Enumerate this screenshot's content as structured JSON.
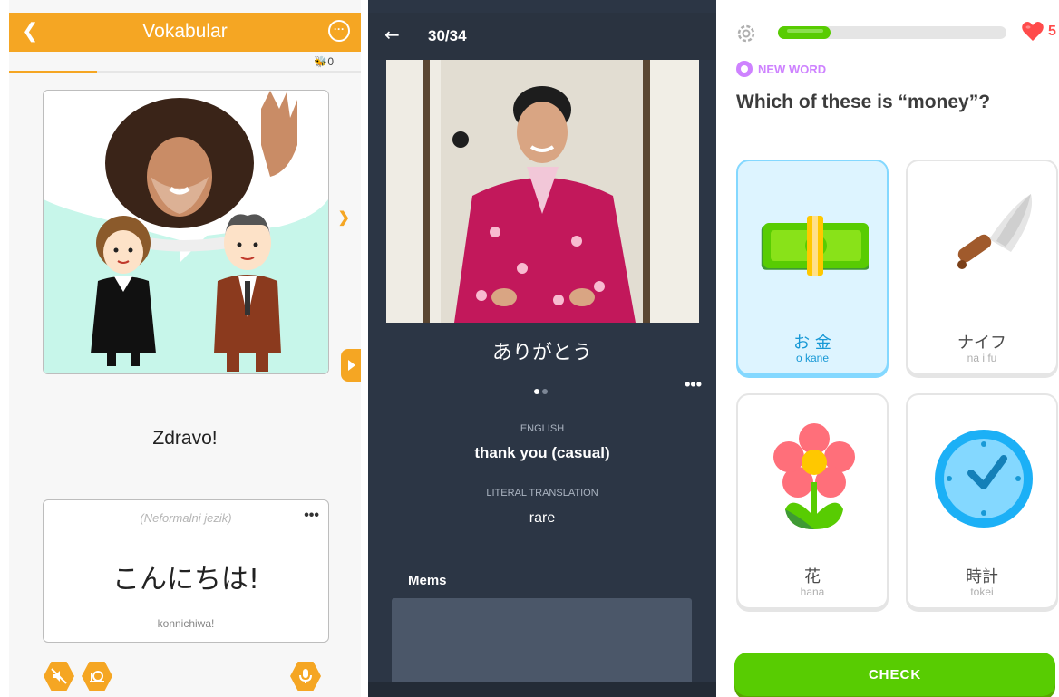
{
  "panel1": {
    "title": "Vokabular",
    "back_icon": "chevron-left-icon",
    "menu_icon": "more-circle-icon",
    "score": "0",
    "word": "Zdravo!",
    "note": "(Neformalni jezik)",
    "japanese": "こんにちは!",
    "romaji": "konnichiwa!",
    "accent": "#f5a623"
  },
  "panel2": {
    "counter": "30/34",
    "japanese": "ありがとう",
    "english_label": "ENGLISH",
    "english": "thank you (casual)",
    "literal_label": "LITERAL TRANSLATION",
    "literal": "rare",
    "mems_label": "Mems",
    "page_active": 1,
    "page_count": 2
  },
  "panel3": {
    "progress": 0.23,
    "hearts": "5",
    "new_word_label": "NEW WORD",
    "question": "Which of these is “money”?",
    "choices": [
      {
        "kanji": "お 金",
        "romaji": "o kane",
        "icon": "money-icon",
        "selected": true
      },
      {
        "kanji": "ナイフ",
        "romaji": "na i fu",
        "icon": "knife-icon",
        "selected": false
      },
      {
        "kanji": "花",
        "romaji": "hana",
        "icon": "flower-icon",
        "selected": false
      },
      {
        "kanji": "時計",
        "romaji": "tokei",
        "icon": "clock-icon",
        "selected": false
      }
    ],
    "check_label": "CHECK",
    "accent": "#58cc02"
  }
}
